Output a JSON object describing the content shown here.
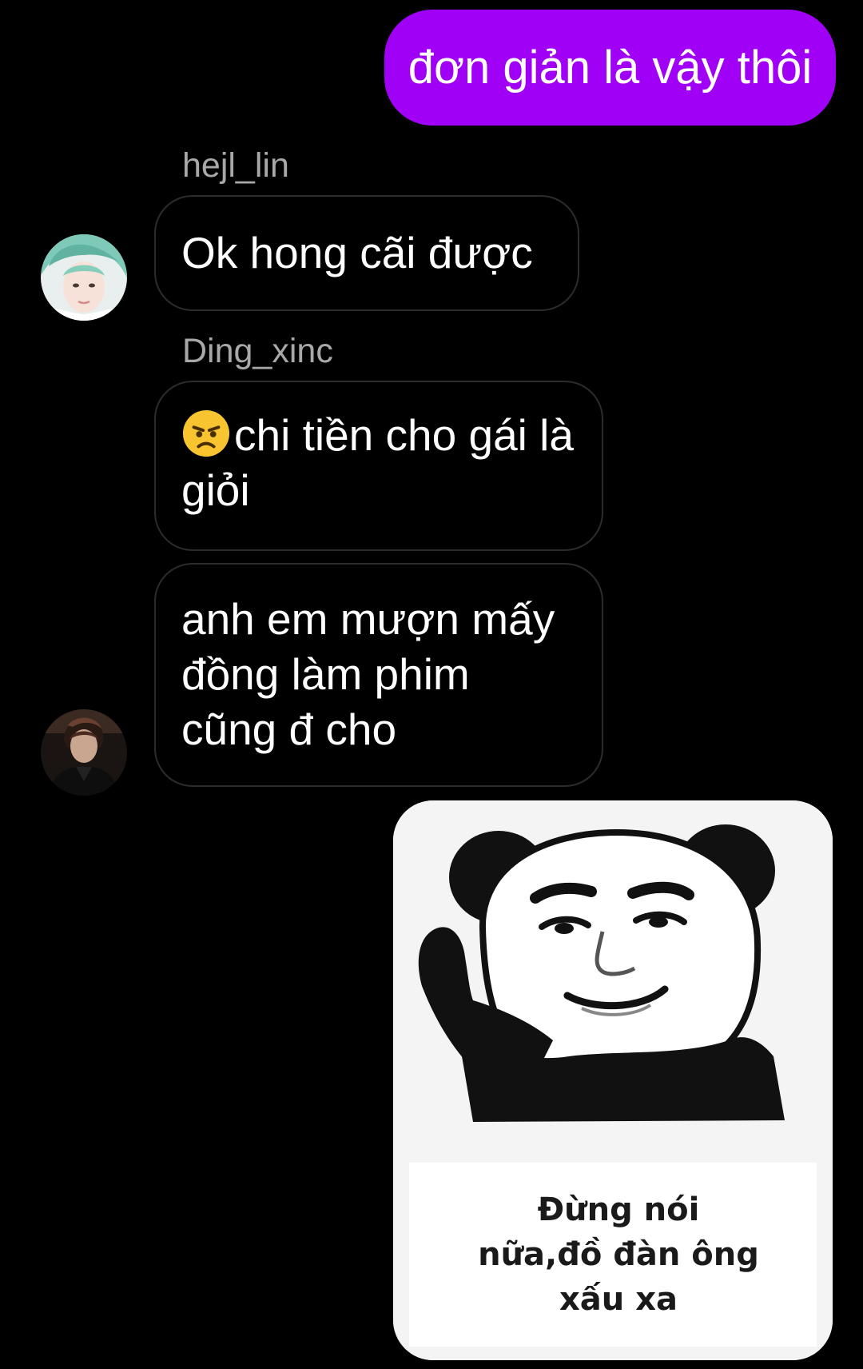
{
  "messages": {
    "outgoing_1": {
      "text": "đơn giản là vậy thôi"
    },
    "incoming_1": {
      "sender": "hejl_lin",
      "text": "Ok hong cãi được"
    },
    "incoming_2": {
      "sender": "Ding_xinc",
      "emoji": "angry-face",
      "text": "chi tiền cho gái là giỏi"
    },
    "incoming_3": {
      "text": "anh em mượn mấy đồng làm phim cũng đ cho"
    },
    "outgoing_sticker": {
      "caption": "Đừng nói nữa,đồ đàn ông xấu xa"
    }
  },
  "colors": {
    "background": "#000000",
    "outgoing_bubble": "#a000f5",
    "incoming_border": "#2c2c2c",
    "sender_name": "#a8a8a8"
  }
}
